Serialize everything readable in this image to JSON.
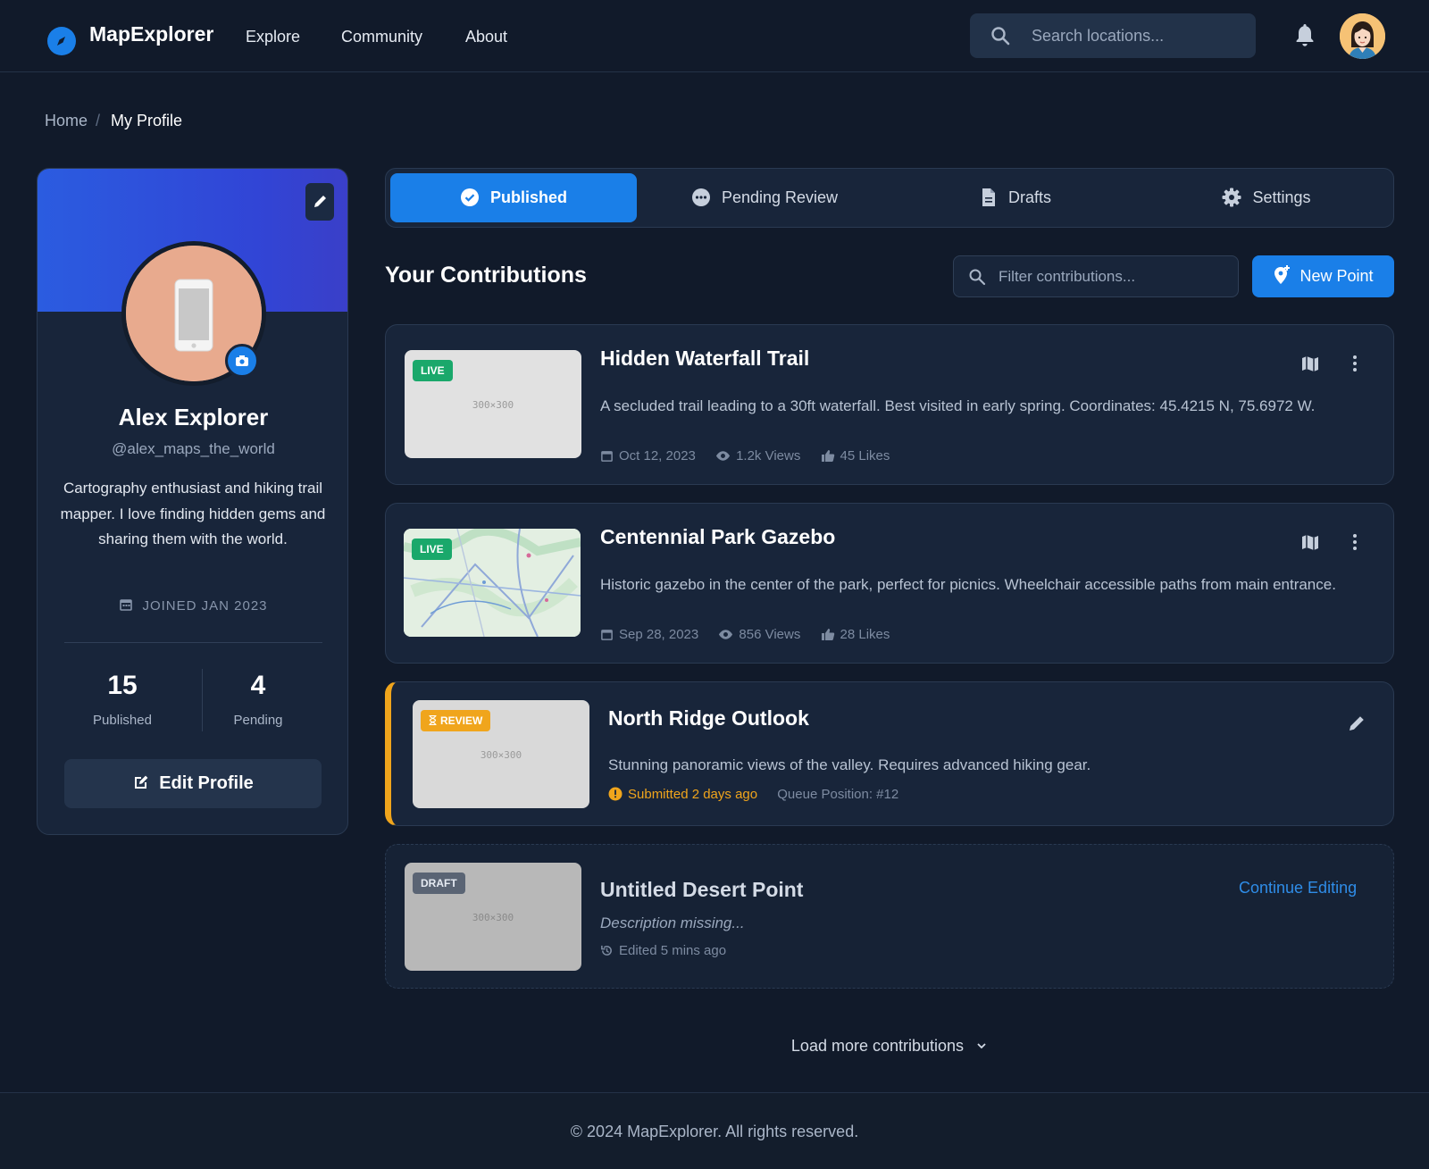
{
  "header": {
    "brand": "MapExplorer",
    "nav": [
      "Explore",
      "Community",
      "About"
    ],
    "search_placeholder": "Search locations...",
    "accent": "#1a7fe8"
  },
  "breadcrumb": {
    "home": "Home",
    "separator": "/",
    "current": "My Profile"
  },
  "profile": {
    "name": "Alex Explorer",
    "handle": "@alex_maps_the_world",
    "bio": "Cartography enthusiast and hiking trail mapper. I love finding hidden gems and sharing them with the world.",
    "joined": "JOINED JAN 2023",
    "stats": {
      "published_count": "15",
      "published_label": "Published",
      "pending_count": "4",
      "pending_label": "Pending"
    },
    "edit_label": "Edit Profile"
  },
  "tabs": [
    {
      "label": "Published",
      "active": true
    },
    {
      "label": "Pending Review",
      "active": false
    },
    {
      "label": "Drafts",
      "active": false
    },
    {
      "label": "Settings",
      "active": false
    }
  ],
  "contributions": {
    "title": "Your Contributions",
    "filter_placeholder": "Filter contributions...",
    "new_point_label": "New Point",
    "items": [
      {
        "status": "LIVE",
        "thumb": "300×300",
        "title": "Hidden Waterfall Trail",
        "description": "A secluded trail leading to a 30ft waterfall. Best visited in early spring. Coordinates: 45.4215 N, 75.6972 W.",
        "date": "Oct 12, 2023",
        "views": "1.2k Views",
        "likes": "45 Likes"
      },
      {
        "status": "LIVE",
        "thumb": "map",
        "title": "Centennial Park Gazebo",
        "description": "Historic gazebo in the center of the park, perfect for picnics. Wheelchair accessible paths from main entrance.",
        "date": "Sep 28, 2023",
        "views": "856 Views",
        "likes": "28 Likes"
      },
      {
        "status": "REVIEW",
        "thumb": "300×300",
        "title": "North Ridge Outlook",
        "description": "Stunning panoramic views of the valley. Requires advanced hiking gear.",
        "submitted": "Submitted 2 days ago",
        "queue": "Queue Position: #12"
      },
      {
        "status": "DRAFT",
        "thumb": "300×300",
        "title": "Untitled Desert Point",
        "description": "Description missing...",
        "edited": "Edited 5 mins ago",
        "action": "Continue Editing"
      }
    ],
    "load_more": "Load more contributions"
  },
  "footer": {
    "copyright": "© 2024 MapExplorer. All rights reserved."
  },
  "colors": {
    "live": "#1aa86b",
    "review": "#f0a51c",
    "draft": "#5a6474"
  }
}
